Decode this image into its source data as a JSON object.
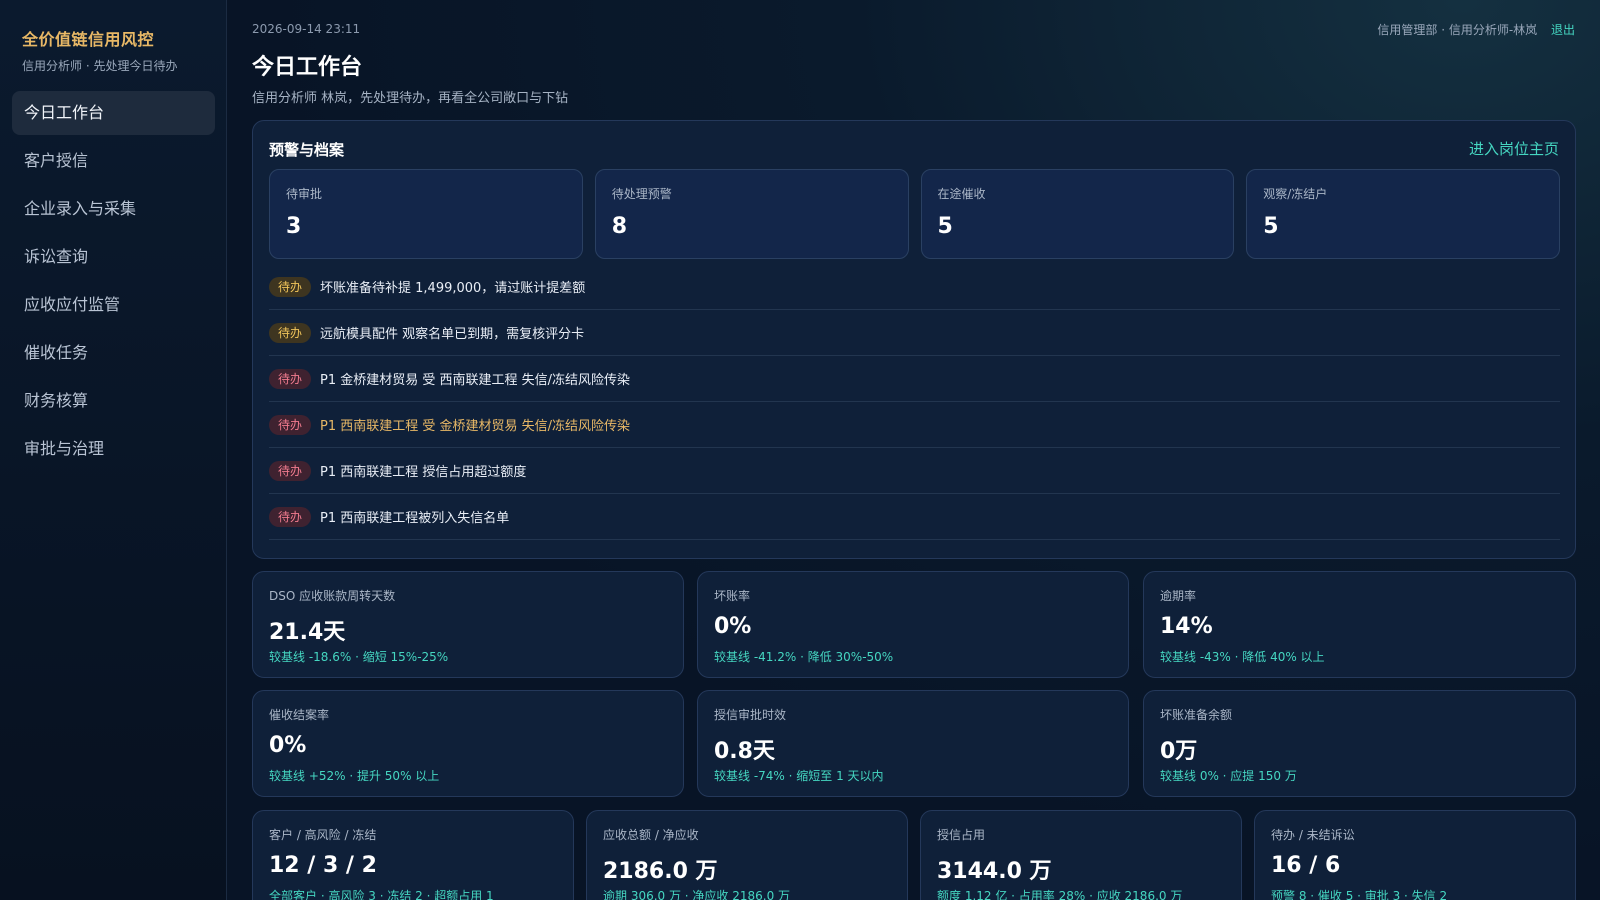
{
  "sidebar": {
    "brand": "全价值链信用风控",
    "subtitle": "信用分析师 · 先处理今日待办",
    "items": [
      {
        "label": "今日工作台",
        "active": true
      },
      {
        "label": "客户授信"
      },
      {
        "label": "企业录入与采集"
      },
      {
        "label": "诉讼查询"
      },
      {
        "label": "应收应付监管"
      },
      {
        "label": "催收任务"
      },
      {
        "label": "财务核算"
      },
      {
        "label": "审批与治理"
      }
    ]
  },
  "header": {
    "timestamp": "2026-09-14 23:11",
    "user": "信用管理部 · 信用分析师-林岚",
    "logout": "退出",
    "title": "今日工作台",
    "subtitle": "信用分析师 林岚，先处理待办，再看全公司敞口与下钻"
  },
  "alerts": {
    "title": "预警与档案",
    "link": "进入岗位主页",
    "stats": [
      {
        "label": "待审批",
        "value": "3"
      },
      {
        "label": "待处理预警",
        "value": "8"
      },
      {
        "label": "在途催收",
        "value": "5"
      },
      {
        "label": "观察/冻结户",
        "value": "5"
      }
    ],
    "todos": [
      {
        "badge": "待办",
        "text": "坏账准备待补提 1,499,000，请过账计提差额",
        "tone": "amber"
      },
      {
        "badge": "待办",
        "text": "远航模具配件 观察名单已到期，需复核评分卡",
        "tone": "amber"
      },
      {
        "badge": "待办",
        "text": "P1 金桥建材贸易 受 西南联建工程 失信/冻结风险传染",
        "tone": "red"
      },
      {
        "badge": "待办",
        "text": "P1 西南联建工程 受 金桥建材贸易 失信/冻结风险传染",
        "tone": "red",
        "highlight": true
      },
      {
        "badge": "待办",
        "text": "P1 西南联建工程 授信占用超过额度",
        "tone": "red"
      },
      {
        "badge": "待办",
        "text": "P1 西南联建工程被列入失信名单",
        "tone": "red"
      }
    ]
  },
  "kpis_row1": [
    {
      "label": "DSO 应收账款周转天数",
      "value": "21.4天",
      "note": "较基线 -18.6% · 缩短 15%-25%"
    },
    {
      "label": "坏账率",
      "value": "0%",
      "note": "较基线 -41.2% · 降低 30%-50%"
    },
    {
      "label": "逾期率",
      "value": "14%",
      "note": "较基线 -43% · 降低 40% 以上"
    }
  ],
  "kpis_row2": [
    {
      "label": "催收结案率",
      "value": "0%",
      "note": "较基线 +52% · 提升 50% 以上"
    },
    {
      "label": "授信审批时效",
      "value": "0.8天",
      "note": "较基线 -74% · 缩短至 1 天以内"
    },
    {
      "label": "坏账准备余额",
      "value": "0万",
      "note": "较基线 0% · 应提 150 万"
    }
  ],
  "kpis_row3": [
    {
      "label": "客户 / 高风险 / 冻结",
      "value": "12 / 3 / 2",
      "note": "全部客户 · 高风险 3 · 冻结 2 · 超额占用 1"
    },
    {
      "label": "应收总额 / 净应收",
      "value": "2186.0 万",
      "note": "逾期 306.0 万 · 净应收 2186.0 万"
    },
    {
      "label": "授信占用",
      "value": "3144.0 万",
      "note": "额度 1.12 亿 · 占用率 28% · 应收 2186.0 万"
    },
    {
      "label": "待办 / 未结诉讼",
      "value": "16 / 6",
      "note": "预警 8 · 催收 5 · 审批 3 · 失信 2"
    }
  ]
}
